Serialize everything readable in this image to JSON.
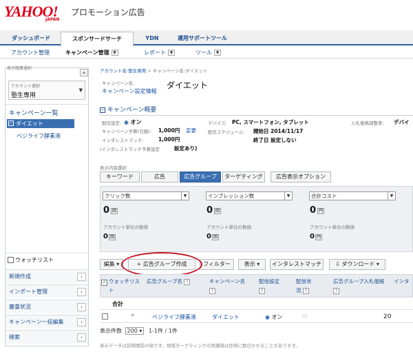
{
  "header": {
    "logo": "YAHOO!",
    "logo_sub": "JAPAN",
    "product": "プロモーション広告"
  },
  "tabs": [
    {
      "label": "ダッシュボード"
    },
    {
      "label": "スポンサードサーチ"
    },
    {
      "label": "YDN"
    },
    {
      "label": "運用サポートツール"
    }
  ],
  "subnav": {
    "account": "アカウント管理",
    "campaign": "キャンペーン管理",
    "report": "レポート",
    "tools": "ツール"
  },
  "sidebar": {
    "display_level": "表示階層選択",
    "collapse": "«",
    "account_select_label": "アカウント選択",
    "account_name": "塾生専用",
    "campaign_list": "キャンペーン一覧",
    "campaign": "ダイエット",
    "adgroup": "ベジライフ酵素液",
    "watchlist": "ウォッチリスト",
    "menu": [
      "新規作成",
      "インポート管理",
      "審査状況",
      "キャンペーン一括編集",
      "検索"
    ]
  },
  "breadcrumb": {
    "account": "アカウント名:塾生専用",
    "sep": ">",
    "campaign": "キャンペーン名:ダイエット"
  },
  "campaign": {
    "name_label": "キャンペーン名:",
    "settings_link": "キャンペーン設定情報",
    "name": "ダイエット",
    "summary_title": "キャンペーン概要",
    "delivery_label": "配信設定:",
    "delivery_value": "オン",
    "budget_label": "キャンペーン予算(日額):",
    "budget_value": "1,000円",
    "budget_change": "変更",
    "interest_label": "インタレストマッチ:",
    "interest_value": "1,000円",
    "interest_budget_label": "(インタレストマッチ予算設定",
    "interest_budget_value": "設定あり)",
    "device_label": "デバイス:",
    "device_value": "PC, スマートフォン, タブレット",
    "schedule_label": "配信スケジュール:",
    "schedule_start": "開始日 2014/11/17",
    "schedule_end": "終了日 設定しない",
    "bid_adjust_label": "入札価格調整率:",
    "bid_adjust_value": "デバイ"
  },
  "content_select": {
    "label": "表示内容選択",
    "tabs": [
      "キーワード",
      "広告",
      "広告グループ",
      "ターゲティング",
      "広告表示オプション"
    ],
    "active_index": 2
  },
  "metrics": [
    {
      "select": "クリック数",
      "value": "0",
      "unit": "回",
      "acct_label": "アカウント単位の数値",
      "acct_value": "0",
      "acct_unit": "回"
    },
    {
      "select": "インプレッション数",
      "value": "0",
      "unit": "回",
      "acct_label": "アカウント単位の数値",
      "acct_value": "0",
      "acct_unit": "回"
    },
    {
      "select": "合計コスト",
      "value": "0",
      "unit": "円",
      "acct_label": "アカウント単位の数値",
      "acct_value": "0",
      "acct_unit": "円"
    }
  ],
  "toolbar": {
    "edit": "編集",
    "create": "+ 広告グループ作成",
    "filter": "フィルター",
    "display": "表示",
    "interest": "インタレストマッチ",
    "download": "ダウンロード"
  },
  "table": {
    "headers": [
      "ウォッチリスト",
      "広告グループ名",
      "キャンペーン名",
      "配信設定",
      "配信状況",
      "広告グループ入札価格",
      "インタ"
    ],
    "total_label": "合計",
    "rows": [
      {
        "adgroup": "ベジライフ酵素液",
        "campaign": "ダイエット",
        "delivery": "オン",
        "bid": "20"
      }
    ]
  },
  "pagination": {
    "label": "表示件数",
    "per_page": "200",
    "range": "1-1件 / 1件"
  },
  "footnote": "表示データは前時間前の値です。地域ターゲティングの実績値は反映に数日かかることがあります。",
  "colors": {
    "brand_red": "#e2001a",
    "link_blue": "#1a55a8",
    "active_tab_blue": "#3a6fb2",
    "highlight_circle": "#c1121f"
  }
}
